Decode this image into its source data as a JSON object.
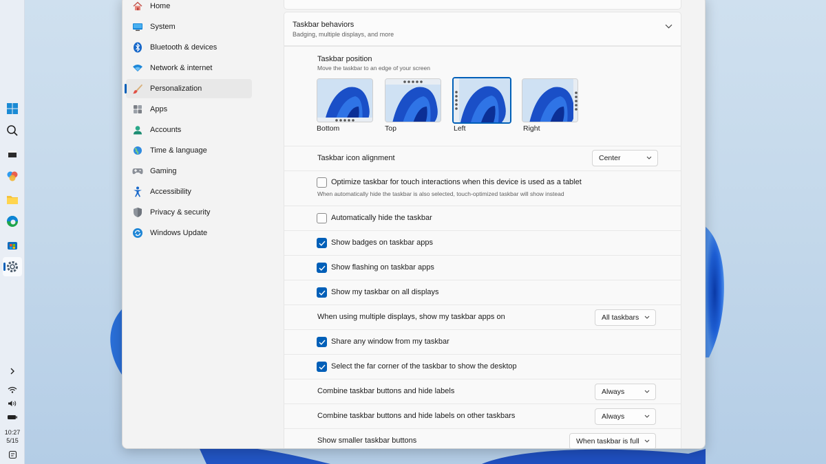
{
  "colors": {
    "accent": "#005fb8",
    "selected_nav": "#e8e8e8",
    "window_bg": "#f3f3f3"
  },
  "taskbar": {
    "icons": [
      "windows-start-icon",
      "search-icon",
      "task-view-icon",
      "copilot-icon",
      "file-explorer-icon",
      "edge-icon",
      "store-icon",
      "settings-icon"
    ],
    "clock_time": "10:27",
    "clock_date": "5/15"
  },
  "nav": {
    "items": [
      {
        "label": "Home",
        "icon": "home-icon"
      },
      {
        "label": "System",
        "icon": "monitor-icon"
      },
      {
        "label": "Bluetooth & devices",
        "icon": "bluetooth-icon"
      },
      {
        "label": "Network & internet",
        "icon": "wifi-icon"
      },
      {
        "label": "Personalization",
        "icon": "brush-icon"
      },
      {
        "label": "Apps",
        "icon": "apps-icon"
      },
      {
        "label": "Accounts",
        "icon": "person-icon"
      },
      {
        "label": "Time & language",
        "icon": "globe-icon"
      },
      {
        "label": "Gaming",
        "icon": "gamepad-icon"
      },
      {
        "label": "Accessibility",
        "icon": "accessibility-icon"
      },
      {
        "label": "Privacy & security",
        "icon": "shield-icon"
      },
      {
        "label": "Windows Update",
        "icon": "update-icon"
      }
    ],
    "selected": "Personalization"
  },
  "behaviors": {
    "title": "Taskbar behaviors",
    "subtitle": "Badging, multiple displays, and more",
    "position": {
      "label": "Taskbar position",
      "desc": "Move the taskbar to an edge of your screen",
      "options": [
        "Bottom",
        "Top",
        "Left",
        "Right"
      ],
      "selected": "Left"
    },
    "alignment": {
      "label": "Taskbar icon alignment",
      "value": "Center"
    },
    "touch": {
      "label": "Optimize taskbar for touch interactions when this device is used as a tablet",
      "desc": "When automatically hide the taskbar is also selected, touch-optimized taskbar will show instead",
      "checked": false
    },
    "autohide": {
      "label": "Automatically hide the taskbar",
      "checked": false
    },
    "badges": {
      "label": "Show badges on taskbar apps",
      "checked": true
    },
    "flashing": {
      "label": "Show flashing on taskbar apps",
      "checked": true
    },
    "all_displays": {
      "label": "Show my taskbar on all displays",
      "checked": true
    },
    "multi_display": {
      "label": "When using multiple displays, show my taskbar apps on",
      "value": "All taskbars"
    },
    "share_window": {
      "label": "Share any window from my taskbar",
      "checked": true
    },
    "far_corner": {
      "label": "Select the far corner of the taskbar to show the desktop",
      "checked": true
    },
    "combine": {
      "label": "Combine taskbar buttons and hide labels",
      "value": "Always"
    },
    "combine_other": {
      "label": "Combine taskbar buttons and hide labels on other taskbars",
      "value": "Always"
    },
    "smaller": {
      "label": "Show smaller taskbar buttons",
      "value": "When taskbar is full"
    }
  }
}
